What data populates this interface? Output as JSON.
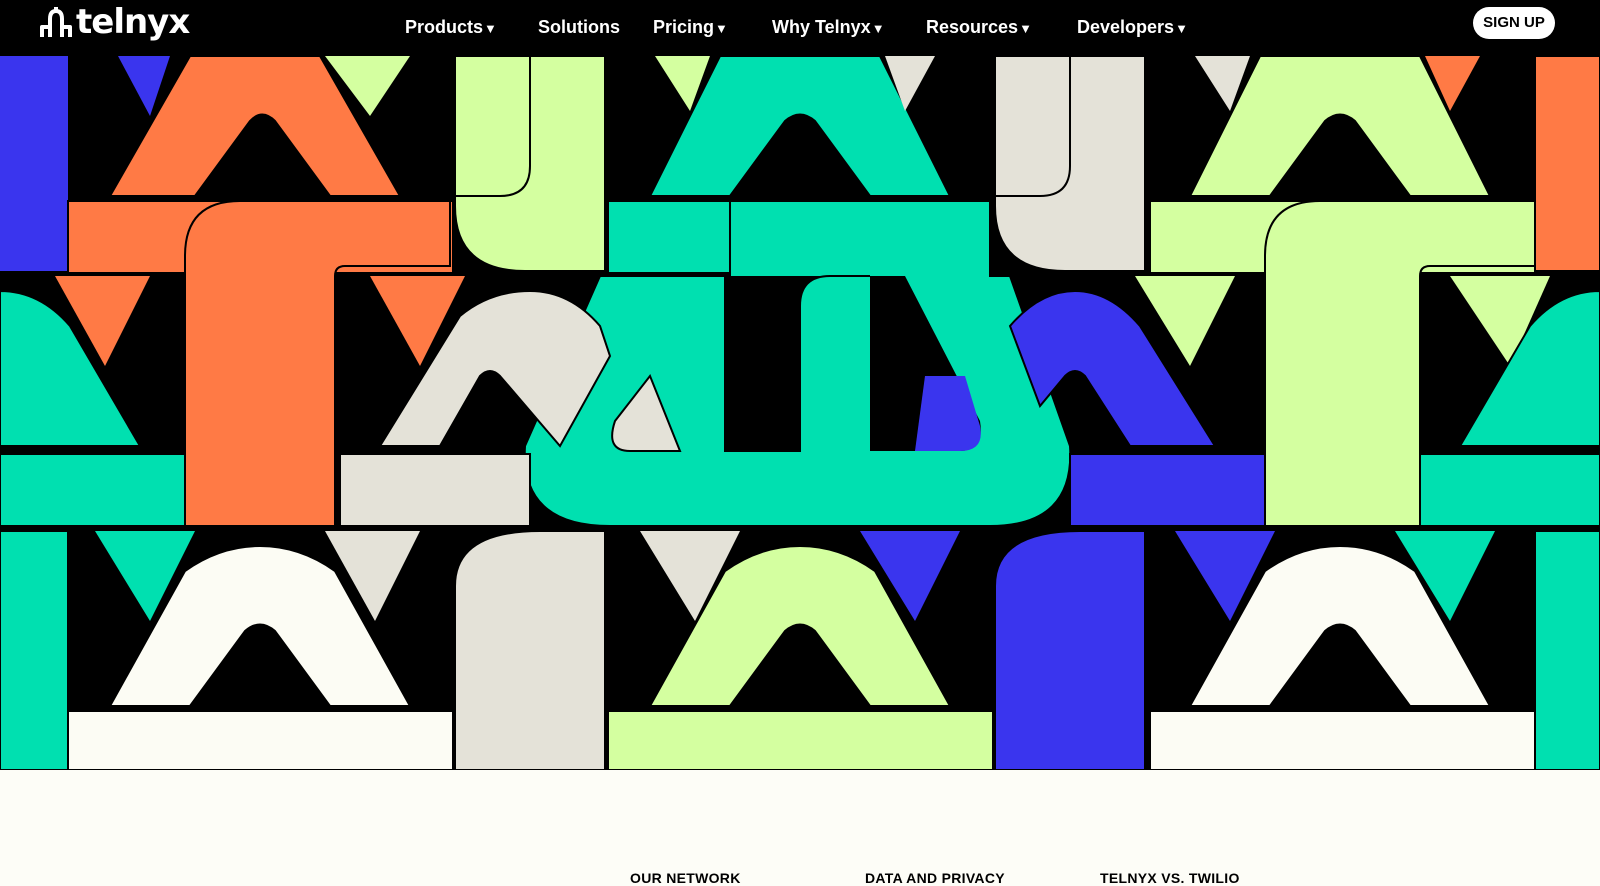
{
  "brand": {
    "name": "telnyx",
    "logo_icon": "telnyx-logo-icon"
  },
  "nav": {
    "items": [
      {
        "label": "Products",
        "has_dropdown": true
      },
      {
        "label": "Solutions",
        "has_dropdown": false
      },
      {
        "label": "Pricing",
        "has_dropdown": true
      },
      {
        "label": "Why Telnyx",
        "has_dropdown": true
      },
      {
        "label": "Resources",
        "has_dropdown": true
      },
      {
        "label": "Developers",
        "has_dropdown": true
      }
    ],
    "caret": "▼",
    "signup_label": "SIGN UP"
  },
  "hero": {
    "pattern": "geometric-arches-pattern",
    "colors": [
      "#00e0b0",
      "#ff7a45",
      "#d4ffa0",
      "#3a35ee",
      "#e4e2d8",
      "#fcfcf4",
      "#000000"
    ]
  },
  "footer": {
    "columns": [
      "OUR NETWORK",
      "DATA AND PRIVACY",
      "TELNYX VS. TWILIO"
    ]
  },
  "colors": {
    "nav_bg": "#000000",
    "page_bg": "#fdfdf7",
    "signup_bg": "#ffffff"
  }
}
